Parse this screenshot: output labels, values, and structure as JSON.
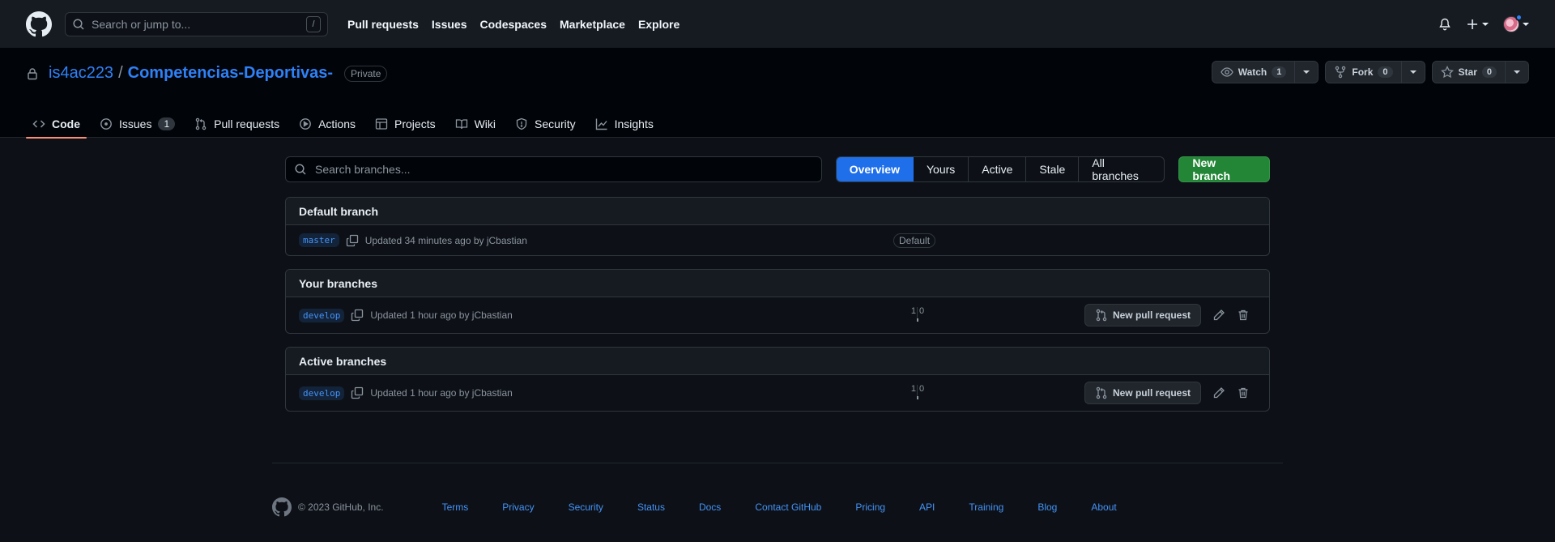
{
  "header": {
    "search_placeholder": "Search or jump to...",
    "search_shortcut": "/",
    "nav": [
      "Pull requests",
      "Issues",
      "Codespaces",
      "Marketplace",
      "Explore"
    ]
  },
  "repo": {
    "owner": "is4ac223",
    "separator": "/",
    "name": "Competencias-Deportivas-",
    "visibility": "Private",
    "watch_label": "Watch",
    "watch_count": "1",
    "fork_label": "Fork",
    "fork_count": "0",
    "star_label": "Star",
    "star_count": "0"
  },
  "tabs": [
    {
      "label": "Code",
      "icon": "code-icon",
      "selected": true
    },
    {
      "label": "Issues",
      "icon": "issue-icon",
      "counter": "1"
    },
    {
      "label": "Pull requests",
      "icon": "pull-request-icon"
    },
    {
      "label": "Actions",
      "icon": "play-icon"
    },
    {
      "label": "Projects",
      "icon": "table-icon"
    },
    {
      "label": "Wiki",
      "icon": "book-icon"
    },
    {
      "label": "Security",
      "icon": "shield-icon"
    },
    {
      "label": "Insights",
      "icon": "graph-icon"
    }
  ],
  "branches_page": {
    "search_placeholder": "Search branches...",
    "filters": [
      "Overview",
      "Yours",
      "Active",
      "Stale",
      "All branches"
    ],
    "selected_filter": "Overview",
    "new_branch_label": "New branch",
    "sections": [
      {
        "title": "Default branch",
        "rows": [
          {
            "branch": "master",
            "updated": "Updated 34 minutes ago by jCbastian",
            "badge": "Default"
          }
        ]
      },
      {
        "title": "Your branches",
        "rows": [
          {
            "branch": "develop",
            "updated": "Updated 1 hour ago by jCbastian",
            "behind": "1",
            "ahead": "0",
            "pr_label": "New pull request"
          }
        ]
      },
      {
        "title": "Active branches",
        "rows": [
          {
            "branch": "develop",
            "updated": "Updated 1 hour ago by jCbastian",
            "behind": "1",
            "ahead": "0",
            "pr_label": "New pull request"
          }
        ]
      }
    ]
  },
  "footer": {
    "copyright": "© 2023 GitHub, Inc.",
    "links": [
      "Terms",
      "Privacy",
      "Security",
      "Status",
      "Docs",
      "Contact GitHub",
      "Pricing",
      "API",
      "Training",
      "Blog",
      "About"
    ]
  },
  "colors": {
    "background": "#0d1117",
    "header": "#161b22",
    "accent_blue": "#1f6feb",
    "link": "#4493f8",
    "success": "#238636",
    "tab_underline": "#fd8c73"
  }
}
